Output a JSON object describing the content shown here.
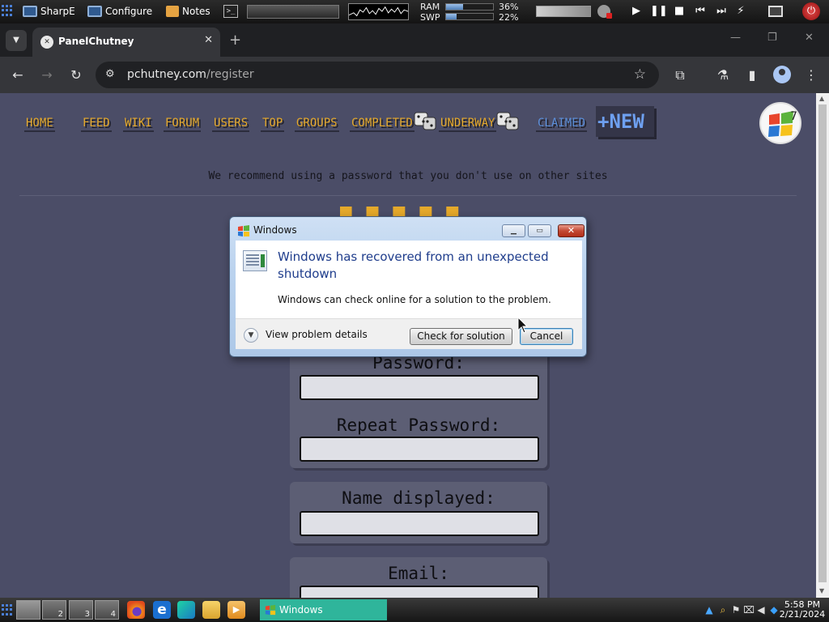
{
  "top_panel": {
    "launchers": [
      {
        "label": "SharpE",
        "icon": "monitor-icon"
      },
      {
        "label": "Configure",
        "icon": "monitor-icon"
      },
      {
        "label": "Notes",
        "icon": "notes-icon"
      }
    ],
    "terminal_icon_glyph": ">_",
    "ram": {
      "label": "RAM",
      "percent": "36%",
      "fill": 0.36
    },
    "swap": {
      "label": "SWP",
      "percent": "22%",
      "fill": 0.22
    },
    "media": [
      "play-icon",
      "pause-icon",
      "stop-icon",
      "previous-icon",
      "next-icon"
    ]
  },
  "browser": {
    "tab_title": "PanelChutney",
    "url_domain": "pchutney.com",
    "url_path": "/register"
  },
  "page": {
    "nav": [
      "HOME",
      "FEED",
      "WIKI",
      "FORUM",
      "USERS",
      "TOP",
      "GROUPS",
      "COMPLETED",
      "UNDERWAY",
      "CLAIMED"
    ],
    "nav_new": "+NEW",
    "notice": "We recommend using a password that you don't use on other sites",
    "form": {
      "password_label": "Password:",
      "repeat_password_label": "Repeat Password:",
      "name_label": "Name displayed:",
      "email_label": "Email:"
    }
  },
  "dialog": {
    "title": "Windows",
    "heading": "Windows has recovered from an unexpected shutdown",
    "body": "Windows can check online for a solution to the problem.",
    "details": "View problem details",
    "check_button": "Check for solution",
    "cancel_button": "Cancel"
  },
  "taskbar": {
    "workspaces": [
      "",
      "2",
      "3",
      "4"
    ],
    "active_workspace": 1,
    "task_label": "Windows",
    "time": "5:58 PM",
    "date": "2/21/2024"
  },
  "colors": {
    "page_bg": "#4b4d67",
    "nav_orange": "#e4a82a",
    "nav_blue": "#5b8ed8",
    "task_teal": "#2fb59b",
    "dialog_heading": "#1f3d8c"
  }
}
